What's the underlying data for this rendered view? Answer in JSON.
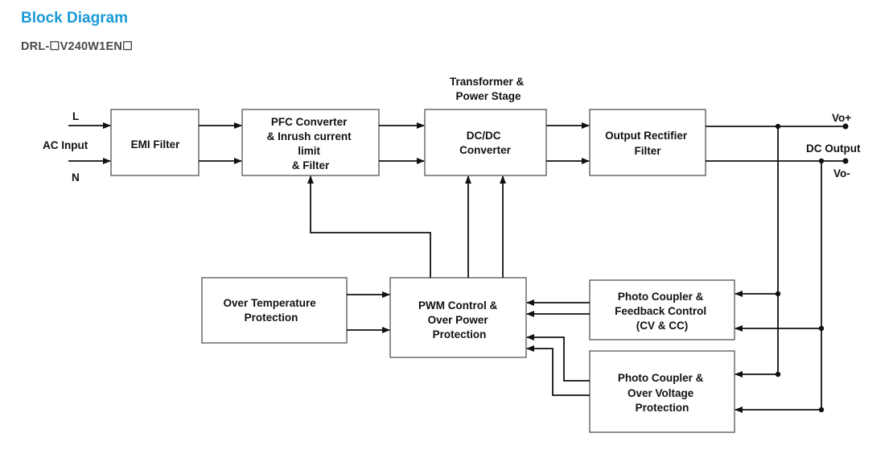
{
  "header": {
    "title": "Block Diagram",
    "model": "DRL-☐V240W1EN☐"
  },
  "colors": {
    "title": "#1a9ad6",
    "model": "#4a4a4a",
    "line": "#111111",
    "box_border": "#555555"
  },
  "labels": {
    "L": "L",
    "ac_input": "AC Input",
    "N": "N",
    "transformer_1": "Transformer &",
    "transformer_2": "Power Stage",
    "vo_plus": "Vo+",
    "dc_output": "DC Output",
    "vo_minus": "Vo-"
  },
  "blocks": {
    "emi": {
      "lines": [
        "EMI Filter"
      ]
    },
    "pfc": {
      "lines": [
        "PFC Converter",
        "& Inrush current",
        "limit",
        "& Filter"
      ]
    },
    "dcdc": {
      "lines": [
        "DC/DC",
        "Converter"
      ]
    },
    "rectifier": {
      "lines": [
        "Output Rectifier",
        "Filter"
      ]
    },
    "otp": {
      "lines": [
        "Over Temperature",
        "Protection"
      ]
    },
    "pwm": {
      "lines": [
        "PWM Control &",
        "Over Power",
        "Protection"
      ]
    },
    "feedback": {
      "lines": [
        "Photo Coupler &",
        "Feedback Control",
        "(CV & CC)"
      ]
    },
    "ovp": {
      "lines": [
        "Photo Coupler &",
        "Over Voltage",
        "Protection"
      ]
    }
  }
}
